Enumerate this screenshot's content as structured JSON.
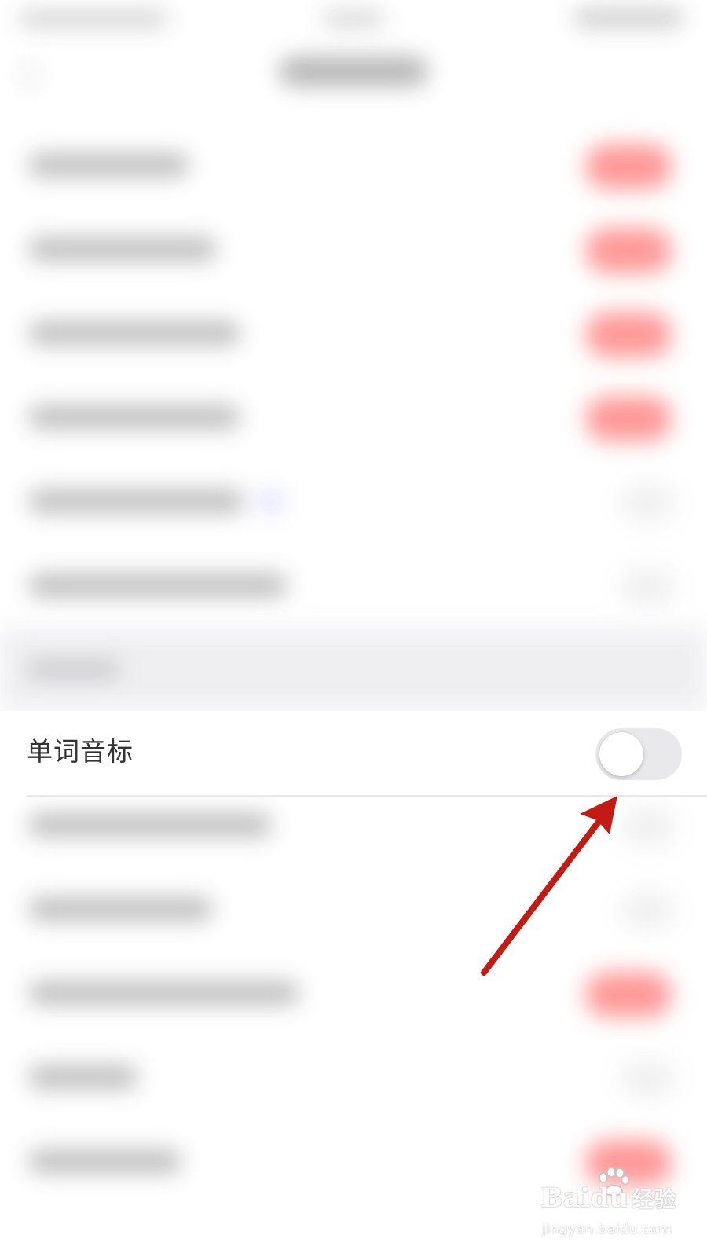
{
  "setting_row": {
    "label": "单词音标",
    "toggle_state": "off"
  },
  "watermark": {
    "brand": "Bai",
    "brand_suffix": "du",
    "brand_cn": "经验",
    "url": "jingyan.baidu.com"
  },
  "colors": {
    "toggle_on_blur": "#ff7a7a",
    "toggle_off_track": "#e9e9ec",
    "arrow": "#c41a14",
    "section_band": "#eeeef1"
  },
  "icons": {
    "back": "chevron-left-icon",
    "paw": "baidu-paw-icon"
  }
}
